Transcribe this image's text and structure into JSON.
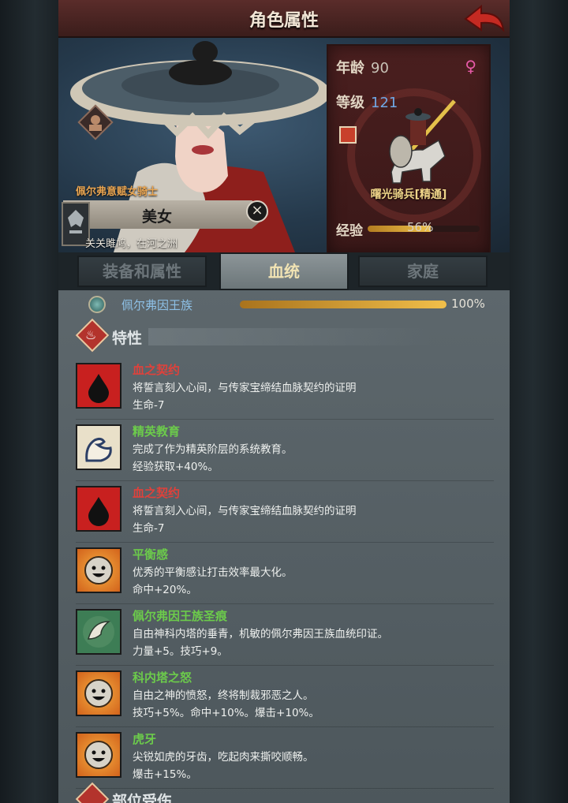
{
  "header": {
    "title": "角色属性"
  },
  "character": {
    "title": "佩尔弗意赋女骑士",
    "name": "美女",
    "motto": "关关雎鸠，在河之洲"
  },
  "info": {
    "age_label": "年龄",
    "age": "90",
    "level_label": "等级",
    "level": "121",
    "unit_name": "曙光骑兵[精通]",
    "exp_label": "经验",
    "exp_percent": "56%",
    "exp_fraction": 0.56,
    "gender_icon": "female-icon"
  },
  "tabs": [
    {
      "label": "装备和属性"
    },
    {
      "label": "血统"
    },
    {
      "label": "家庭"
    }
  ],
  "bloodline": {
    "name": "佩尔弗因王族",
    "percent": "100%",
    "fraction": 1.0
  },
  "sections": {
    "traits": "特性",
    "next": "部位受伤"
  },
  "traits": [
    {
      "name": "血之契约",
      "desc": "将誓言刻入心间，与传家宝缔结血脉契约的证明",
      "effect": "生命-7",
      "icon": "blood-drop-icon"
    },
    {
      "name": "精英教育",
      "desc": "完成了作为精英阶层的系统教育。",
      "effect": "经验获取+40%。",
      "icon": "flexed-arm-icon"
    },
    {
      "name": "血之契约",
      "desc": "将誓言刻入心间，与传家宝缔结血脉契约的证明",
      "effect": "生命-7",
      "icon": "blood-drop-icon"
    },
    {
      "name": "平衡感",
      "desc": "优秀的平衡感让打击效率最大化。",
      "effect": "命中+20%。",
      "icon": "smiley-sun-icon"
    },
    {
      "name": "佩尔弗因王族圣痕",
      "desc": "自由神科内塔的垂青，机敏的佩尔弗因王族血统印证。",
      "effect": "力量+5。技巧+9。",
      "icon": "feather-mark-icon"
    },
    {
      "name": "科内塔之怒",
      "desc": "自由之神的愤怒，终将制裁邪恶之人。",
      "effect": "技巧+5%。命中+10%。爆击+10%。",
      "icon": "smiley-sun-icon"
    },
    {
      "name": "虎牙",
      "desc": "尖锐如虎的牙齿，吃起肉来撕咬顺畅。",
      "effect": "爆击+15%。",
      "icon": "smiley-sun-icon"
    }
  ],
  "colors": {
    "trait_red": "#e0413b",
    "trait_green": "#6ccb4b",
    "level_blue": "#6fa8e6"
  }
}
